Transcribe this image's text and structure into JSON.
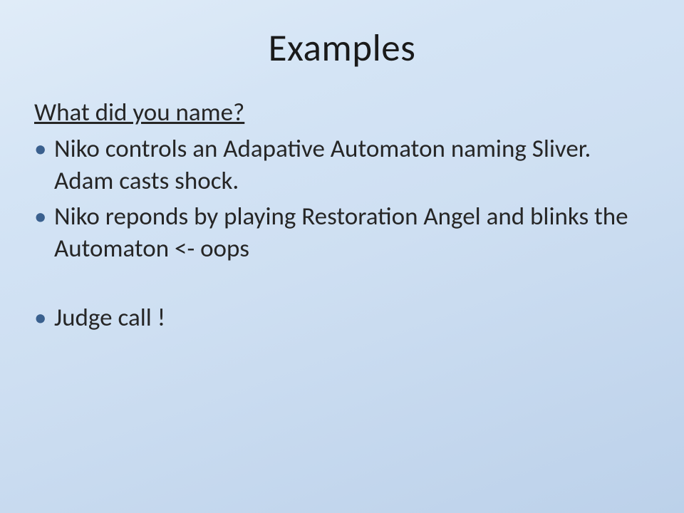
{
  "slide": {
    "title": "Examples",
    "heading": "What did you name?",
    "bullets": [
      "Niko controls an Adapative Automaton naming Sliver. Adam casts shock.",
      "Niko reponds by playing Restoration Angel and blinks the Automaton <- oops",
      "Judge call !"
    ]
  }
}
